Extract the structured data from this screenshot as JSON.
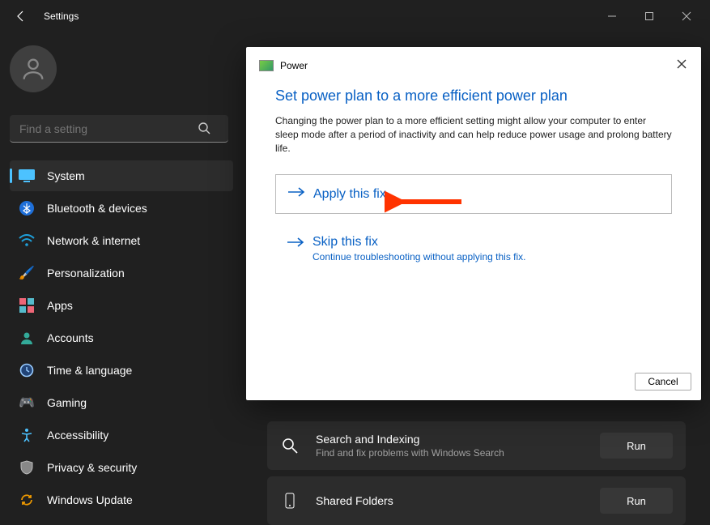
{
  "app_title": "Settings",
  "search_placeholder": "Find a setting",
  "nav": [
    {
      "label": "System"
    },
    {
      "label": "Bluetooth & devices"
    },
    {
      "label": "Network & internet"
    },
    {
      "label": "Personalization"
    },
    {
      "label": "Apps"
    },
    {
      "label": "Accounts"
    },
    {
      "label": "Time & language"
    },
    {
      "label": "Gaming"
    },
    {
      "label": "Accessibility"
    },
    {
      "label": "Privacy & security"
    },
    {
      "label": "Windows Update"
    }
  ],
  "troubleshoot_rows": [
    {
      "title": "Search and Indexing",
      "subtitle": "Find and fix problems with Windows Search",
      "button": "Run"
    },
    {
      "title": "Shared Folders",
      "subtitle": "",
      "button": "Run"
    }
  ],
  "dialog": {
    "tool": "Power",
    "heading": "Set power plan to a more efficient power plan",
    "description": "Changing the power plan to a more efficient setting might allow your computer to enter sleep mode after a period of inactivity and can help reduce power usage and prolong battery life.",
    "apply": "Apply this fix",
    "skip": "Skip this fix",
    "skip_sub": "Continue troubleshooting without applying this fix.",
    "cancel": "Cancel"
  }
}
